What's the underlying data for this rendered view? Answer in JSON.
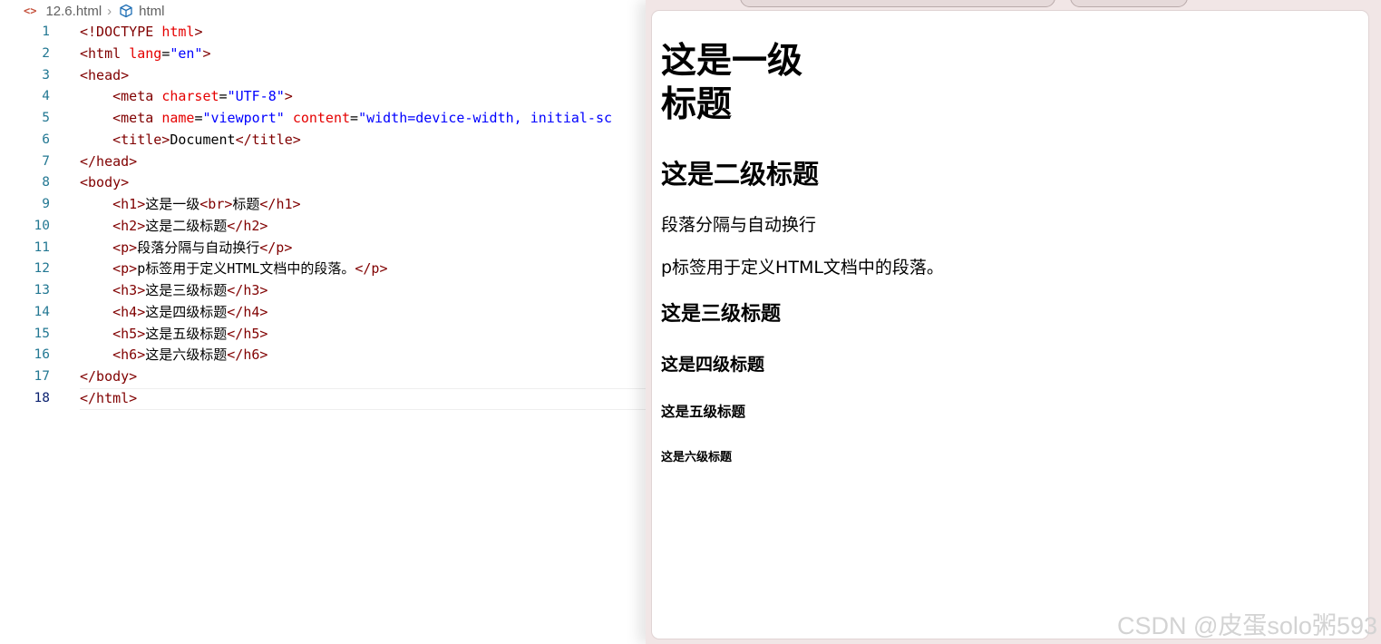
{
  "breadcrumb": {
    "file_icon": "<>",
    "file": "12.6.html",
    "separator": "›",
    "symbol_icon": "cube-icon",
    "symbol": "html"
  },
  "editor": {
    "line_numbers": [
      "1",
      "2",
      "3",
      "4",
      "5",
      "6",
      "7",
      "8",
      "9",
      "10",
      "11",
      "12",
      "13",
      "14",
      "15",
      "16",
      "17",
      "18"
    ],
    "active_line": 18,
    "lines": [
      [
        {
          "c": "t",
          "s": "<!DOCTYPE "
        },
        {
          "c": "a",
          "s": "html"
        },
        {
          "c": "t",
          "s": ">"
        }
      ],
      [
        {
          "c": "t",
          "s": "<html "
        },
        {
          "c": "a",
          "s": "lang"
        },
        {
          "c": "txt",
          "s": "="
        },
        {
          "c": "v",
          "s": "\"en\""
        },
        {
          "c": "t",
          "s": ">"
        }
      ],
      [
        {
          "c": "t",
          "s": "<head>"
        }
      ],
      [
        {
          "c": "txt",
          "s": "    "
        },
        {
          "c": "t",
          "s": "<meta "
        },
        {
          "c": "a",
          "s": "charset"
        },
        {
          "c": "txt",
          "s": "="
        },
        {
          "c": "v",
          "s": "\"UTF-8\""
        },
        {
          "c": "t",
          "s": ">"
        }
      ],
      [
        {
          "c": "txt",
          "s": "    "
        },
        {
          "c": "t",
          "s": "<meta "
        },
        {
          "c": "a",
          "s": "name"
        },
        {
          "c": "txt",
          "s": "="
        },
        {
          "c": "v",
          "s": "\"viewport\""
        },
        {
          "c": "txt",
          "s": " "
        },
        {
          "c": "a",
          "s": "content"
        },
        {
          "c": "txt",
          "s": "="
        },
        {
          "c": "v",
          "s": "\"width=device-width, initial-sc"
        }
      ],
      [
        {
          "c": "txt",
          "s": "    "
        },
        {
          "c": "t",
          "s": "<title>"
        },
        {
          "c": "txt",
          "s": "Document"
        },
        {
          "c": "t",
          "s": "</title>"
        }
      ],
      [
        {
          "c": "t",
          "s": "</head>"
        }
      ],
      [
        {
          "c": "t",
          "s": "<body>"
        }
      ],
      [
        {
          "c": "txt",
          "s": "    "
        },
        {
          "c": "t",
          "s": "<h1>"
        },
        {
          "c": "txt",
          "s": "这是一级"
        },
        {
          "c": "t",
          "s": "<br>"
        },
        {
          "c": "txt",
          "s": "标题"
        },
        {
          "c": "t",
          "s": "</h1>"
        }
      ],
      [
        {
          "c": "txt",
          "s": "    "
        },
        {
          "c": "t",
          "s": "<h2>"
        },
        {
          "c": "txt",
          "s": "这是二级标题"
        },
        {
          "c": "t",
          "s": "</h2>"
        }
      ],
      [
        {
          "c": "txt",
          "s": "    "
        },
        {
          "c": "t",
          "s": "<p>"
        },
        {
          "c": "txt",
          "s": "段落分隔与自动换行"
        },
        {
          "c": "t",
          "s": "</p>"
        }
      ],
      [
        {
          "c": "txt",
          "s": "    "
        },
        {
          "c": "t",
          "s": "<p>"
        },
        {
          "c": "txt",
          "s": "p标签用于定义HTML文档中的段落。"
        },
        {
          "c": "t",
          "s": "</p>"
        }
      ],
      [
        {
          "c": "txt",
          "s": "    "
        },
        {
          "c": "t",
          "s": "<h3>"
        },
        {
          "c": "txt",
          "s": "这是三级标题"
        },
        {
          "c": "t",
          "s": "</h3>"
        }
      ],
      [
        {
          "c": "txt",
          "s": "    "
        },
        {
          "c": "t",
          "s": "<h4>"
        },
        {
          "c": "txt",
          "s": "这是四级标题"
        },
        {
          "c": "t",
          "s": "</h4>"
        }
      ],
      [
        {
          "c": "txt",
          "s": "    "
        },
        {
          "c": "t",
          "s": "<h5>"
        },
        {
          "c": "txt",
          "s": "这是五级标题"
        },
        {
          "c": "t",
          "s": "</h5>"
        }
      ],
      [
        {
          "c": "txt",
          "s": "    "
        },
        {
          "c": "t",
          "s": "<h6>"
        },
        {
          "c": "txt",
          "s": "这是六级标题"
        },
        {
          "c": "t",
          "s": "</h6>"
        }
      ],
      [
        {
          "c": "t",
          "s": "</body>"
        }
      ],
      [
        {
          "c": "t",
          "s": "</html>"
        }
      ]
    ]
  },
  "preview": {
    "h1_line1": "这是一级",
    "h1_line2": "标题",
    "h2": "这是二级标题",
    "p1": "段落分隔与自动换行",
    "p2": "p标签用于定义HTML文档中的段落。",
    "h3": "这是三级标题",
    "h4": "这是四级标题",
    "h5": "这是五级标题",
    "h6": "这是六级标题"
  },
  "watermark": "CSDN @皮蛋solo粥593",
  "colors": {
    "tag": "#800000",
    "attribute": "#e50000",
    "string": "#0000ff",
    "line_number": "#237893",
    "preview_frame": "#f1e6e6"
  }
}
